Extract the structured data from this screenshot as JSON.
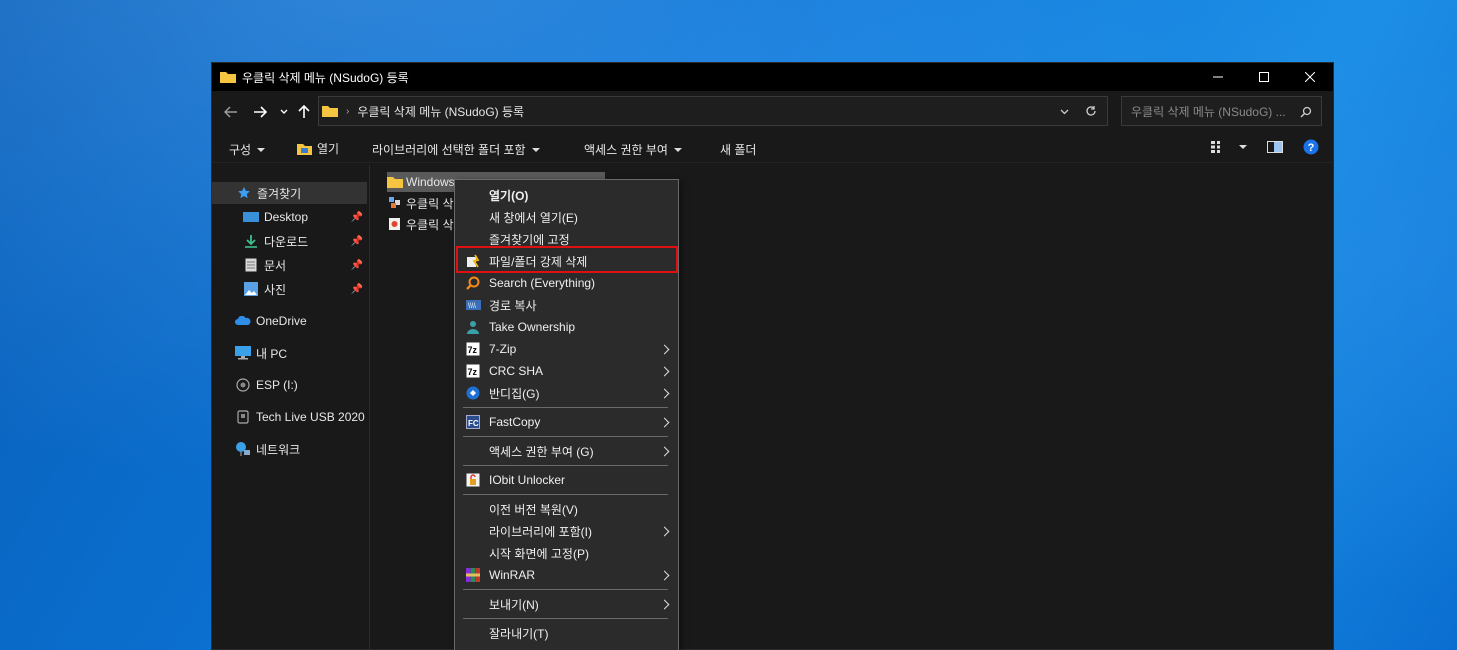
{
  "window": {
    "title": "우클릭 삭제 메뉴 (NSudoG) 등록"
  },
  "address": {
    "path": "우클릭 삭제 메뉴 (NSudoG) 등록",
    "search_placeholder": "우클릭 삭제 메뉴 (NSudoG) ..."
  },
  "ribbon": {
    "organize": "구성",
    "open": "열기",
    "include_library": "라이브러리에 선택한 폴더 포함",
    "grant_access": "액세스 권한 부여",
    "new_folder": "새 폴더"
  },
  "sidebar": {
    "items": [
      {
        "label": "즐겨찾기",
        "icon": "star-icon"
      },
      {
        "label": "Desktop",
        "icon": "desktop-icon"
      },
      {
        "label": "다운로드",
        "icon": "download-icon"
      },
      {
        "label": "문서",
        "icon": "document-icon"
      },
      {
        "label": "사진",
        "icon": "picture-icon"
      },
      {
        "label": "OneDrive",
        "icon": "cloud-icon"
      },
      {
        "label": "내 PC",
        "icon": "pc-icon"
      },
      {
        "label": "ESP (I:)",
        "icon": "drive-icon"
      },
      {
        "label": "Tech Live USB 2020",
        "icon": "usb-drive-icon"
      },
      {
        "label": "네트워크",
        "icon": "network-icon"
      }
    ]
  },
  "files": [
    {
      "name": "Windows",
      "icon": "folder-icon"
    },
    {
      "name": "우클릭 삭",
      "icon": "registry-icon"
    },
    {
      "name": "우클릭 삭",
      "icon": "registry-icon"
    }
  ],
  "context_menu": {
    "items": [
      {
        "label": "열기(O)"
      },
      {
        "label": "새 창에서 열기(E)"
      },
      {
        "label": "즐겨찾기에 고정"
      },
      {
        "label": "파일/폴더 강제 삭제"
      },
      {
        "label": "Search (Everything)"
      },
      {
        "label": "경로 복사"
      },
      {
        "label": "Take Ownership"
      },
      {
        "label": "7-Zip"
      },
      {
        "label": "CRC SHA"
      },
      {
        "label": "반디집(G)"
      },
      {
        "label": "FastCopy"
      },
      {
        "label": "액세스 권한 부여 (G)"
      },
      {
        "label": "IObit Unlocker"
      },
      {
        "label": "이전 버전 복원(V)"
      },
      {
        "label": "라이브러리에 포함(I)"
      },
      {
        "label": "시작 화면에 고정(P)"
      },
      {
        "label": "WinRAR"
      },
      {
        "label": "보내기(N)"
      },
      {
        "label": "잘라내기(T)"
      }
    ]
  },
  "colors": {
    "highlight_border": "#e01010",
    "folder_yellow": "#f5c542",
    "accent_blue": "#1a73e8"
  }
}
